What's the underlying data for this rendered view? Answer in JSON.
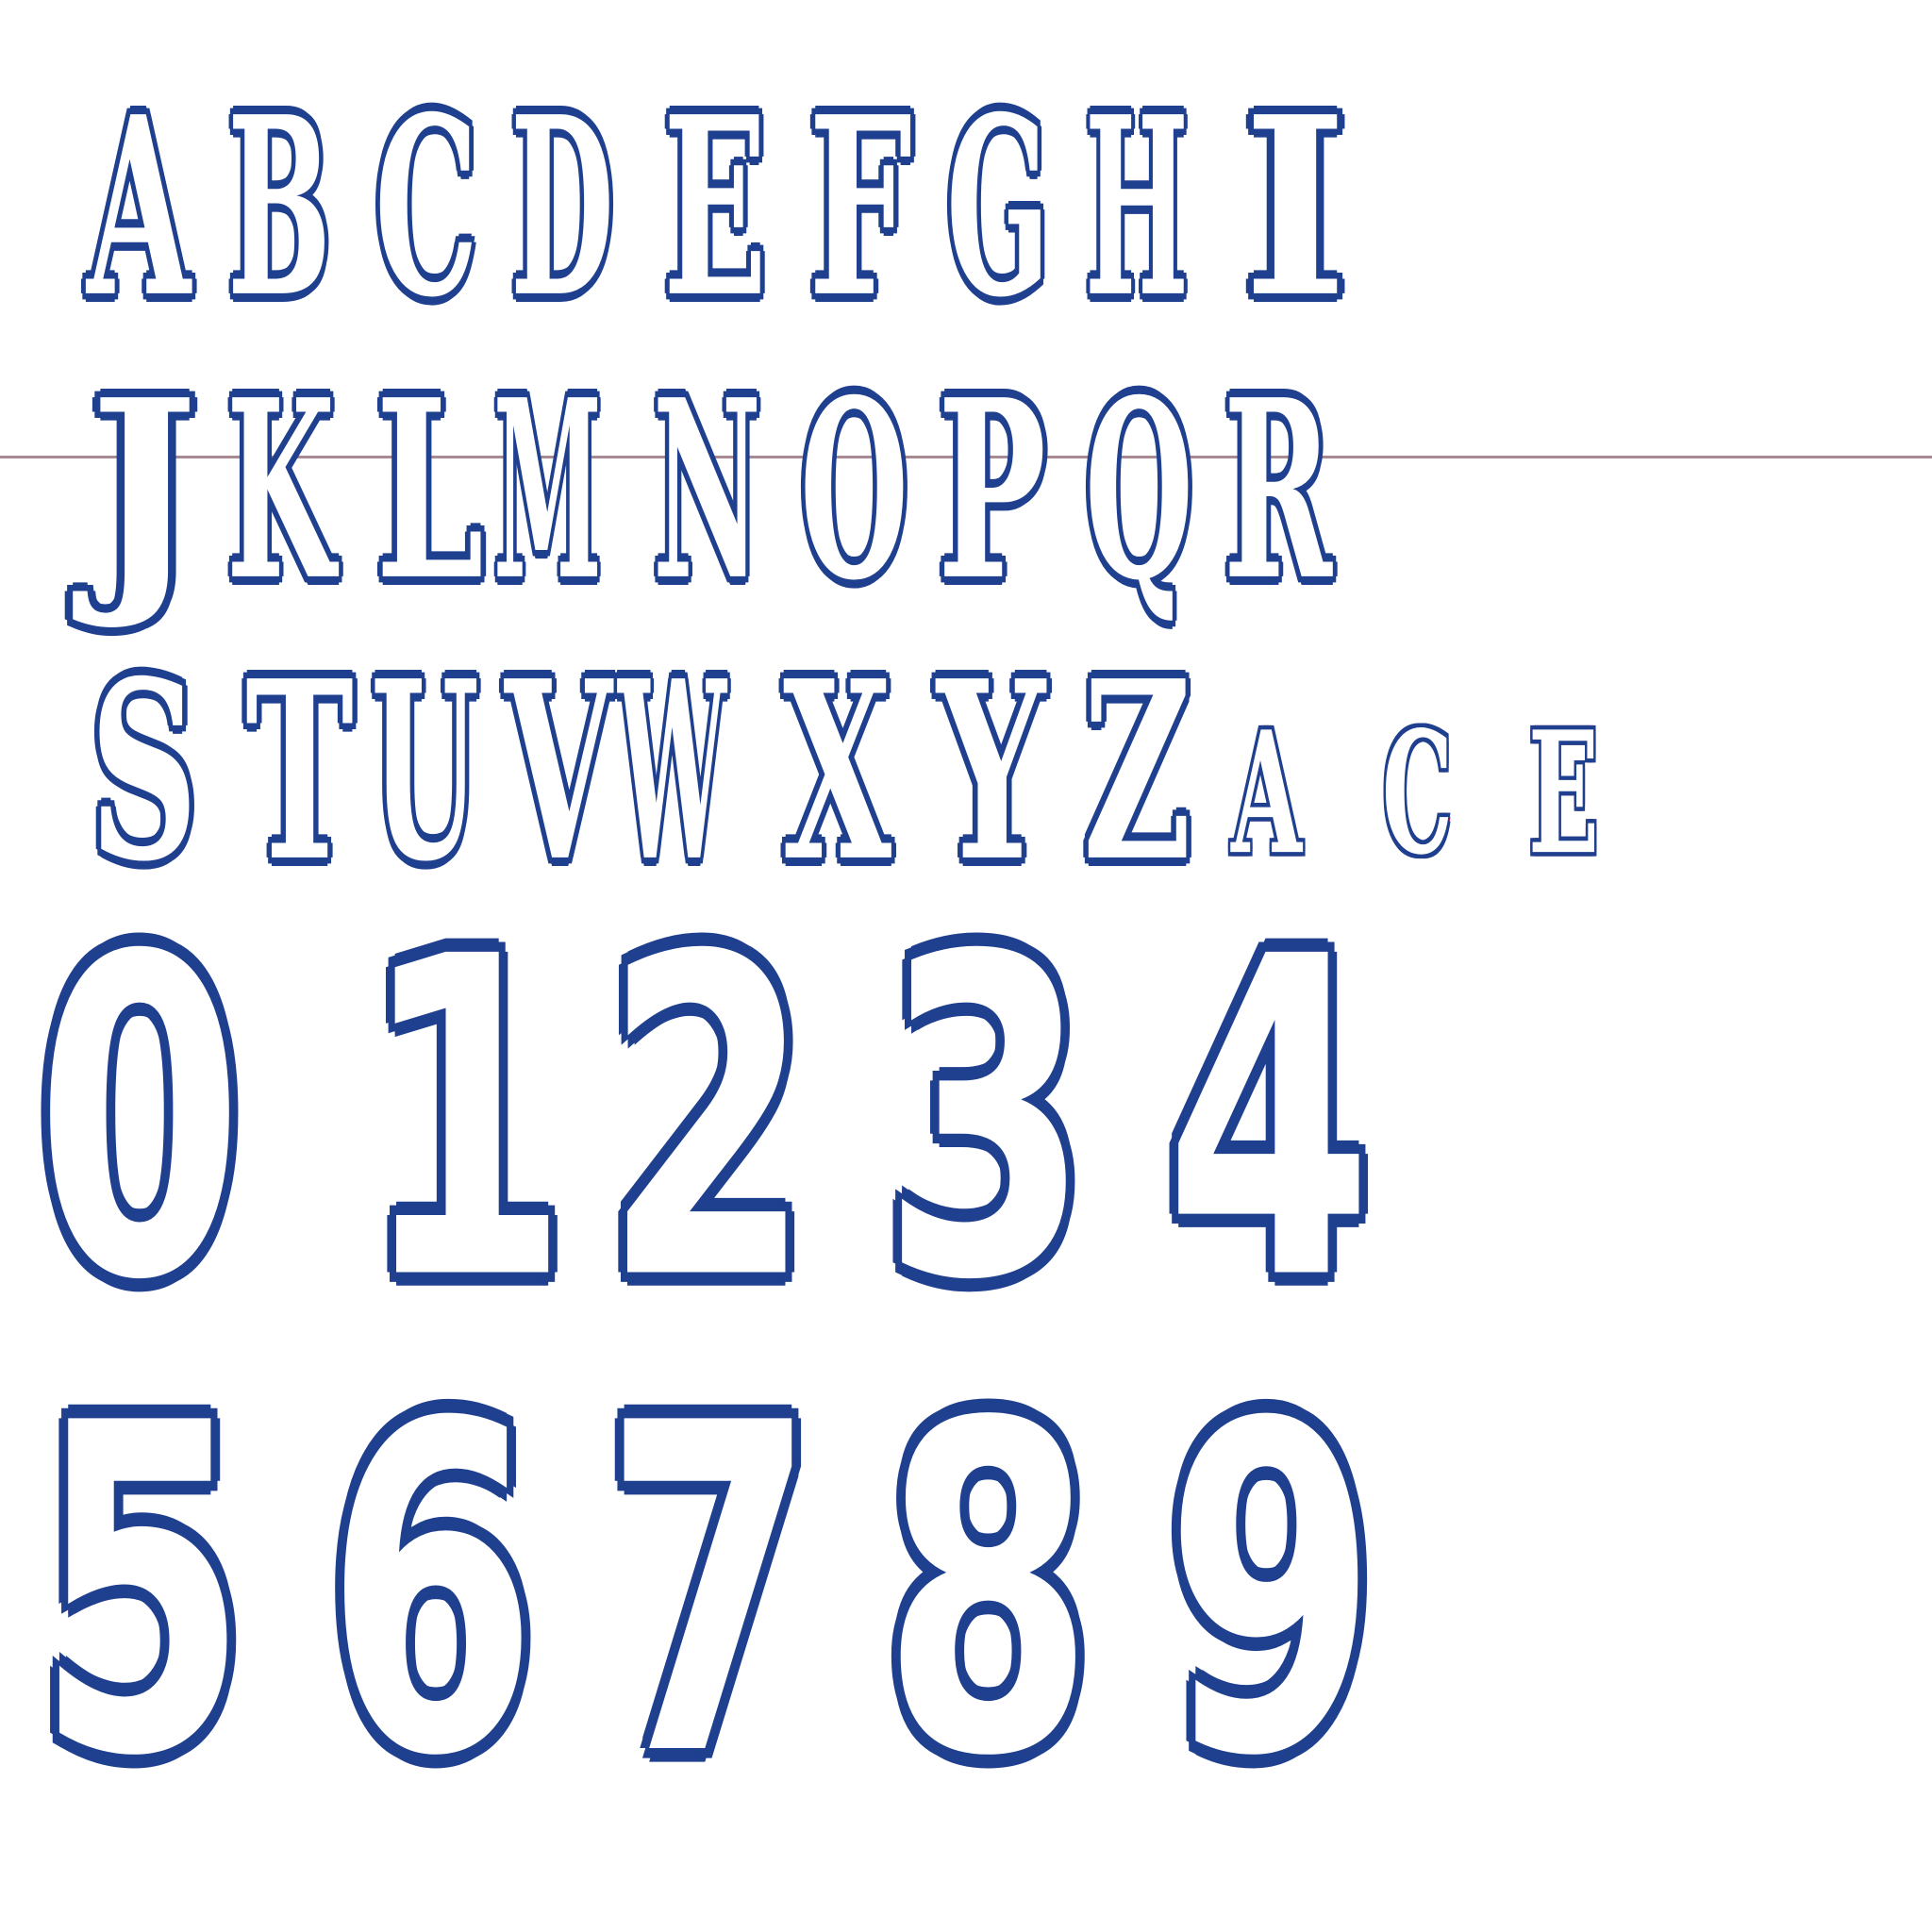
{
  "rows": {
    "row1": [
      "A",
      "B",
      "C",
      "D",
      "E",
      "F",
      "G",
      "H",
      "I"
    ],
    "row2": [
      "J",
      "K",
      "L",
      "M",
      "N",
      "O",
      "P",
      "Q",
      "R"
    ],
    "row3": [
      "S",
      "T",
      "U",
      "V",
      "W",
      "X",
      "Y",
      "Z"
    ],
    "small_letters": [
      "A",
      "C",
      "E"
    ],
    "digits_row1": [
      "0",
      "1",
      "2",
      "3",
      "4"
    ],
    "digits_row2": [
      "5",
      "6",
      "7",
      "8",
      "9"
    ]
  },
  "colors": {
    "outline_outer": "#1f3f8f",
    "outline_inner": "#e0173c",
    "fill": "#ffffff",
    "rule_line": "#a98992"
  }
}
